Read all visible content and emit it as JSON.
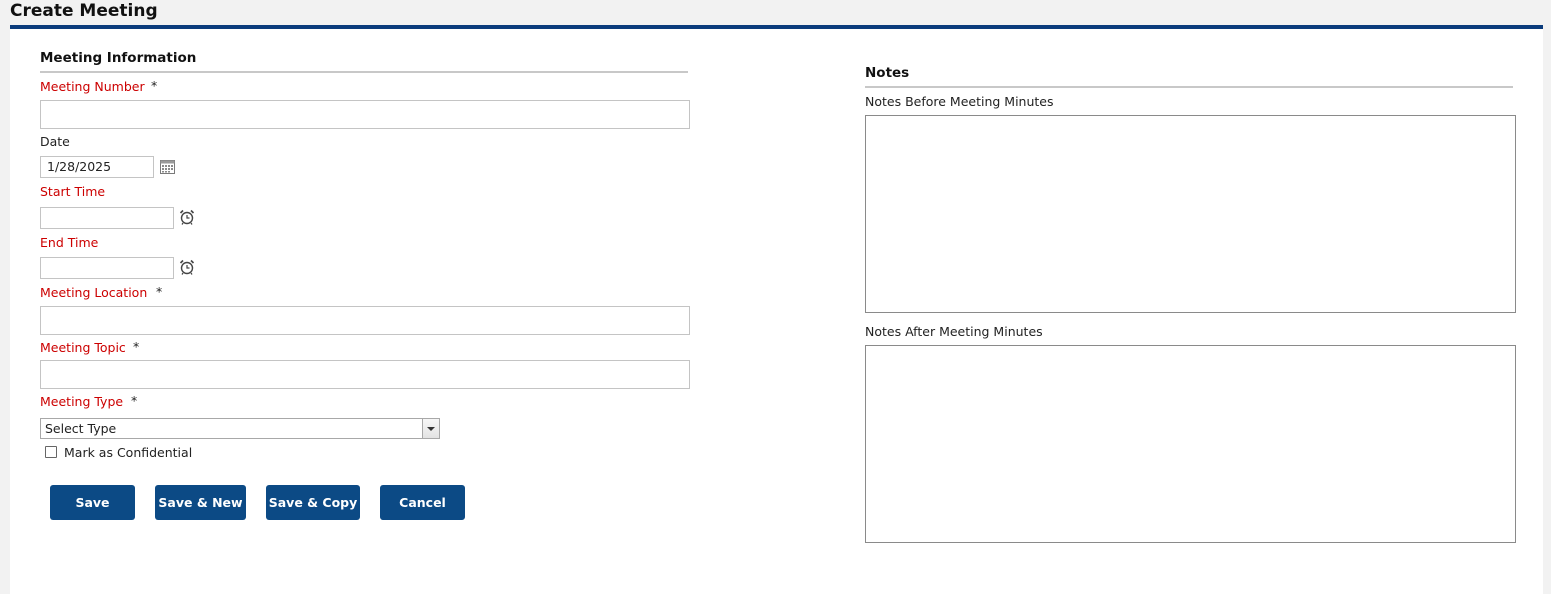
{
  "page": {
    "title": "Create Meeting"
  },
  "meeting_info": {
    "section_title": "Meeting Information",
    "meeting_number": {
      "label": "Meeting Number",
      "required_mark": "*",
      "value": ""
    },
    "date": {
      "label": "Date",
      "value": "1/28/2025",
      "icon": "calendar-icon"
    },
    "start_time": {
      "label": "Start Time",
      "value": "",
      "icon": "alarm-clock-icon"
    },
    "end_time": {
      "label": "End Time",
      "value": "",
      "icon": "alarm-clock-icon"
    },
    "meeting_location": {
      "label": "Meeting Location",
      "required_mark": "*",
      "value": ""
    },
    "meeting_topic": {
      "label": "Meeting Topic",
      "required_mark": "*",
      "value": ""
    },
    "meeting_type": {
      "label": "Meeting Type",
      "required_mark": "*",
      "selected": "Select Type",
      "icon": "chevron-down-icon"
    },
    "confidential": {
      "label": "Mark as Confidential",
      "checked": false
    }
  },
  "buttons": {
    "save": "Save",
    "save_new": "Save & New",
    "save_copy": "Save & Copy",
    "cancel": "Cancel"
  },
  "notes": {
    "section_title": "Notes",
    "before_label": "Notes Before Meeting Minutes",
    "before_value": "",
    "after_label": "Notes After Meeting Minutes",
    "after_value": ""
  },
  "colors": {
    "accent": "#0b3c7c",
    "button": "#0c4a85",
    "required_label": "#cc0000"
  }
}
